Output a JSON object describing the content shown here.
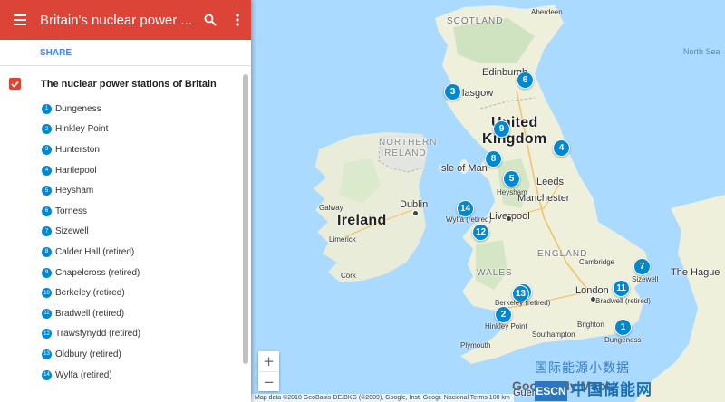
{
  "header": {
    "title": "Britain's nuclear power ...",
    "share_label": "SHARE",
    "accent": "#db4437"
  },
  "layer": {
    "name": "The nuclear power stations of Britain",
    "checked": true,
    "marker_color": "#0288d1"
  },
  "stations": [
    {
      "num": "1",
      "name": "Dungeness"
    },
    {
      "num": "2",
      "name": "Hinkley Point"
    },
    {
      "num": "3",
      "name": "Hunterston"
    },
    {
      "num": "4",
      "name": "Hartlepool"
    },
    {
      "num": "5",
      "name": "Heysham"
    },
    {
      "num": "6",
      "name": "Torness"
    },
    {
      "num": "7",
      "name": "Sizewell"
    },
    {
      "num": "8",
      "name": "Calder Hall (retired)"
    },
    {
      "num": "9",
      "name": "Chapelcross (retired)"
    },
    {
      "num": "10",
      "name": "Berkeley (retired)"
    },
    {
      "num": "11",
      "name": "Bradwell (retired)"
    },
    {
      "num": "12",
      "name": "Trawsfynydd (retired)"
    },
    {
      "num": "13",
      "name": "Oldbury (retired)"
    },
    {
      "num": "14",
      "name": "Wylfa (retired)"
    }
  ],
  "map": {
    "labels": {
      "scotland": "SCOTLAND",
      "aberdeen": "Aberdeen",
      "north_sea": "North Sea",
      "edinburgh": "Edinburgh",
      "glasgow": "lasgow",
      "united": "United",
      "kingdom": "Kingdom",
      "northern_ireland": "NORTHERN IRELAND",
      "isle_of_man": "Isle of Man",
      "heysham": "Heysham",
      "leeds": "Leeds",
      "manchester": "Manchester",
      "galway": "Galway",
      "dublin": "Dublin",
      "ireland": "Ireland",
      "wylfa": "Wylfa (retired)",
      "liverpool": "Liverpool",
      "limerick": "Limerick",
      "cork": "Cork",
      "wales": "WALES",
      "england": "ENGLAND",
      "cambridge": "Cambridge",
      "sizewell": "Sizewell",
      "the_hague": "The Hague",
      "london": "London",
      "bradwell": "Bradwell (retired)",
      "berkeley": "Berkeley (retired)",
      "hinkley": "Hinkley Point",
      "southampton": "Southampton",
      "brighton": "Brighton",
      "dungeness": "Dungeness",
      "plymouth": "Plymouth",
      "guernsey": "Guernse"
    },
    "google_logo": "Google My Maps",
    "attribution": "Map data ©2018 GeoBasis-DE/BKG (©2009), Google, Inst. Geogr. Nacional    Terms    100 km",
    "zoom_in": "+",
    "zoom_out": "−"
  },
  "watermark": {
    "top": "国际能源小数据",
    "logo": "ESCN",
    "bottom": "中国储能网"
  }
}
